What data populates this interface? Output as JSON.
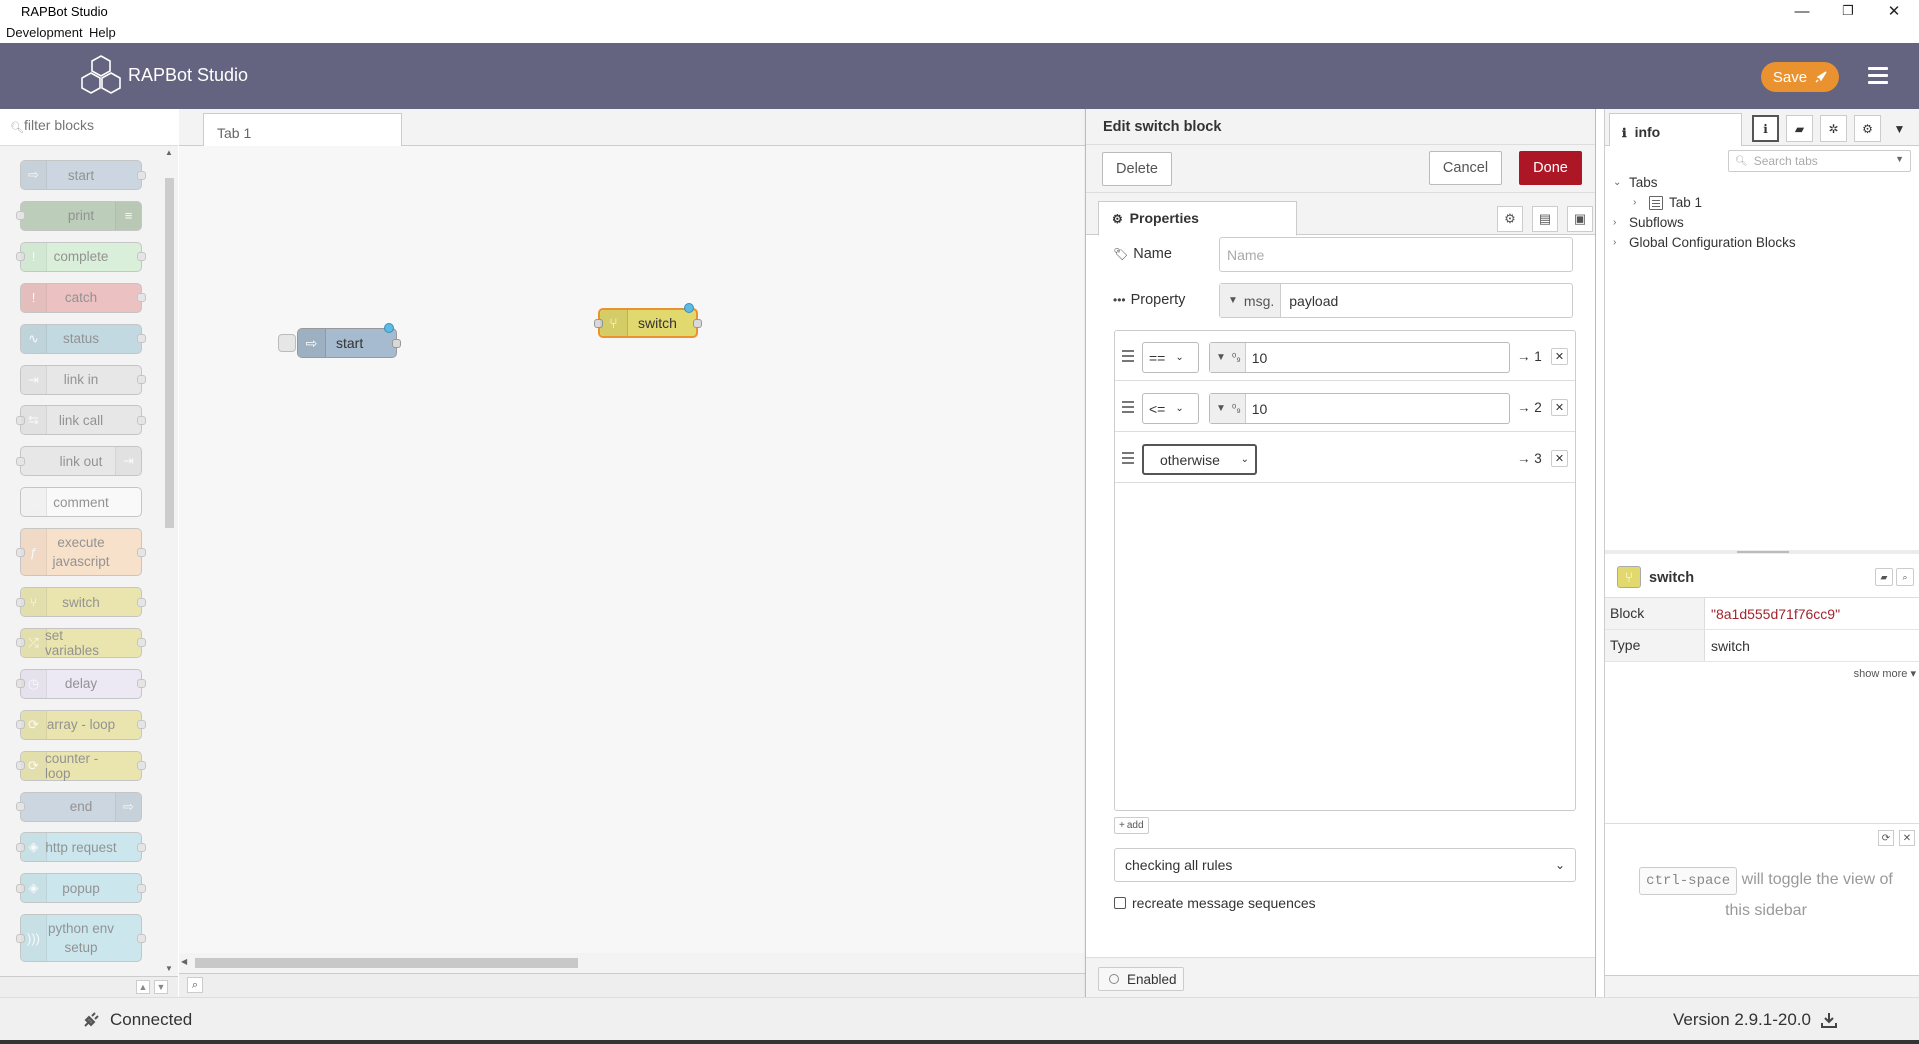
{
  "window": {
    "title": "RAPBot Studio",
    "menu": [
      "Development",
      "Help"
    ],
    "controls": [
      "—",
      "❐",
      "✕"
    ]
  },
  "header": {
    "app_name": "RAPBot Studio",
    "save_label": "Save",
    "accent_color": "#e9922f",
    "bar_color": "#646480"
  },
  "palette": {
    "filter_placeholder": "filter blocks",
    "nodes": [
      {
        "label": "start",
        "color": "#a6bbcf",
        "icon": "arrow-right-icon",
        "icon_side": "left",
        "in": false,
        "out": true
      },
      {
        "label": "print",
        "color": "#87a980",
        "icon": "list-icon",
        "icon_side": "right",
        "in": true,
        "out": false
      },
      {
        "label": "complete",
        "color": "#c0edc0",
        "icon": "exclamation-icon",
        "icon_side": "left",
        "in": true,
        "out": true
      },
      {
        "label": "catch",
        "color": "#e49191",
        "icon": "exclamation-icon",
        "icon_side": "left",
        "in": false,
        "out": true
      },
      {
        "label": "status",
        "color": "#94c1d0",
        "icon": "pulse-icon",
        "icon_side": "left",
        "in": false,
        "out": true
      },
      {
        "label": "link in",
        "color": "#dddddd",
        "icon": "link-in-icon",
        "icon_side": "left",
        "in": false,
        "out": true
      },
      {
        "label": "link call",
        "color": "#dddddd",
        "icon": "link-call-icon",
        "icon_side": "left",
        "in": true,
        "out": true
      },
      {
        "label": "link out",
        "color": "#dddddd",
        "icon": "link-out-icon",
        "icon_side": "right",
        "in": true,
        "out": false
      },
      {
        "label": "comment",
        "color": "#ffffff",
        "icon": "comment-icon",
        "icon_side": "left",
        "in": false,
        "out": false
      },
      {
        "label": "execute javascript",
        "color": "#fdd0a2",
        "icon": "function-icon",
        "icon_side": "left",
        "in": true,
        "out": true,
        "tall": true
      },
      {
        "label": "switch",
        "color": "#e2d96e",
        "icon": "switch-icon",
        "icon_side": "left",
        "in": true,
        "out": true
      },
      {
        "label": "set variables",
        "color": "#e2d96e",
        "icon": "shuffle-icon",
        "icon_side": "left",
        "in": true,
        "out": true
      },
      {
        "label": "delay",
        "color": "#e6e0f8",
        "icon": "clock-icon",
        "icon_side": "left",
        "in": true,
        "out": true
      },
      {
        "label": "array - loop",
        "color": "#e2d96e",
        "icon": "loop-icon",
        "icon_side": "left",
        "in": true,
        "out": true
      },
      {
        "label": "counter - loop",
        "color": "#e2d96e",
        "icon": "loop-icon",
        "icon_side": "left",
        "in": true,
        "out": true
      },
      {
        "label": "end",
        "color": "#a6bbcf",
        "icon": "arrow-right-icon",
        "icon_side": "right",
        "in": true,
        "out": false
      },
      {
        "label": "http request",
        "color": "#a6dbe8",
        "icon": "globe-icon",
        "icon_side": "left",
        "in": true,
        "out": true
      },
      {
        "label": "popup",
        "color": "#a6dbe8",
        "icon": "popup-icon",
        "icon_side": "left",
        "in": true,
        "out": true
      },
      {
        "label": "python env setup",
        "color": "#a6dbe8",
        "icon": "wave-icon",
        "icon_side": "left",
        "in": true,
        "out": true,
        "tall": true
      }
    ]
  },
  "workspace": {
    "tab_label": "Tab 1",
    "nodes": [
      {
        "label": "start",
        "color": "#a6bbcf",
        "icon": "arrow-right-icon"
      },
      {
        "label": "switch",
        "color": "#e2d96e",
        "icon": "switch-icon"
      }
    ]
  },
  "tray": {
    "title": "Edit switch block",
    "delete_label": "Delete",
    "cancel_label": "Cancel",
    "done_label": "Done",
    "tab_label": "Properties",
    "name_label": "Name",
    "name_placeholder": "Name",
    "name_value": "",
    "property_label": "Property",
    "property_type": "msg.",
    "property_value": "payload",
    "rules": [
      {
        "operator": "==",
        "value_type": "⁰₉",
        "value": "10",
        "output": "→ 1"
      },
      {
        "operator": "<=",
        "value_type": "⁰₉",
        "value": "10",
        "output": "→ 2"
      },
      {
        "operator": "otherwise",
        "value_type": "",
        "value": "",
        "output": "→ 3"
      }
    ],
    "add_label": "add",
    "check_mode": "checking all rules",
    "recreate_label": "recreate message sequences",
    "recreate_checked": false,
    "enabled_label": "Enabled"
  },
  "sidebar": {
    "tab_label": "info",
    "search_placeholder": "Search tabs",
    "tree": [
      {
        "label": "Tabs",
        "expanded": true
      },
      {
        "label": "Tab 1",
        "expanded": false,
        "child": true
      },
      {
        "label": "Subflows",
        "expanded": false
      },
      {
        "label": "Global Configuration Blocks",
        "expanded": false
      }
    ],
    "node_title": "switch",
    "node_info": [
      {
        "key": "Block",
        "value": "\"8a1d555d71f76cc9\""
      },
      {
        "key": "Type",
        "value": "switch"
      }
    ],
    "show_more": "show more ▾",
    "help_key": "ctrl-space",
    "help_text": "will toggle the view of this sidebar"
  },
  "status": {
    "connection": "Connected",
    "version": "Version 2.9.1-20.0"
  }
}
